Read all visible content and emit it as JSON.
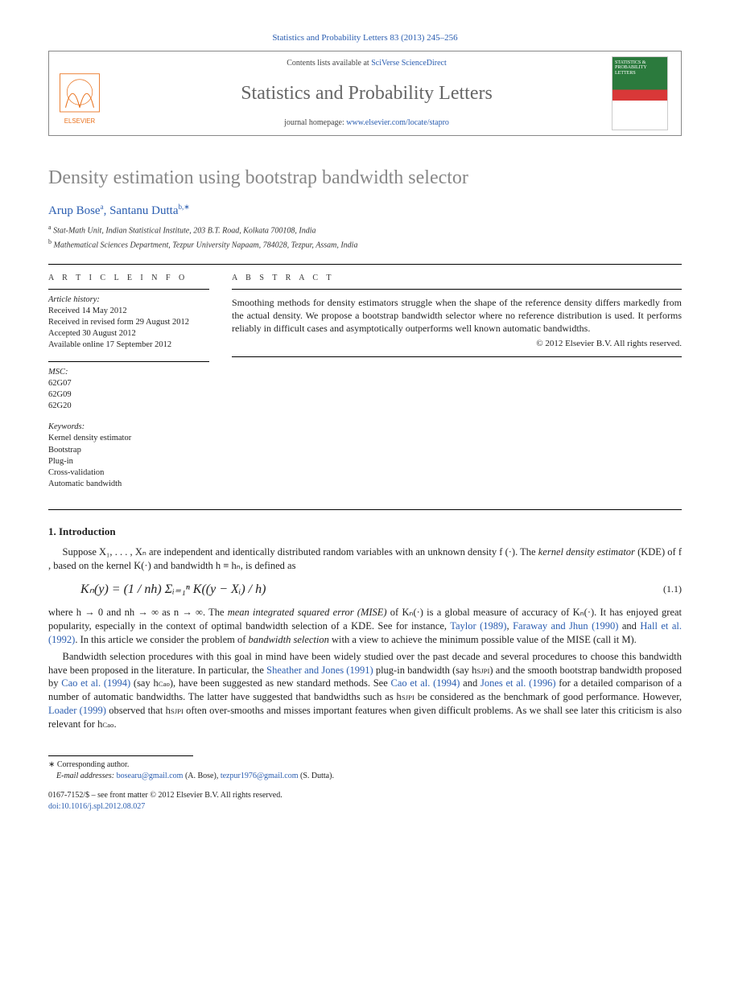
{
  "citation": "Statistics and Probability Letters 83 (2013) 245–256",
  "journalBox": {
    "contentsPrefix": "Contents lists available at ",
    "contentsLink": "SciVerse ScienceDirect",
    "journalName": "Statistics and Probability Letters",
    "homepagePrefix": "journal homepage: ",
    "homepageLink": "www.elsevier.com/locate/stapro",
    "coverTitle": "STATISTICS & PROBABILITY LETTERS"
  },
  "title": "Density estimation using bootstrap bandwidth selector",
  "authors": {
    "a1_name": "Arup Bose",
    "a1_sup": "a",
    "a2_name": "Santanu Dutta",
    "a2_sup": "b,∗"
  },
  "affiliations": {
    "a": "Stat-Math Unit, Indian Statistical Institute, 203 B.T. Road, Kolkata 700108, India",
    "b": "Mathematical Sciences Department, Tezpur University Napaam, 784028, Tezpur, Assam, India"
  },
  "articleInfo": {
    "label": "A R T I C L E   I N F O",
    "historyLabel": "Article history:",
    "h1": "Received 14 May 2012",
    "h2": "Received in revised form 29 August 2012",
    "h3": "Accepted 30 August 2012",
    "h4": "Available online 17 September 2012",
    "mscLabel": "MSC:",
    "msc1": "62G07",
    "msc2": "62G09",
    "msc3": "62G20",
    "kwLabel": "Keywords:",
    "kw1": "Kernel density estimator",
    "kw2": "Bootstrap",
    "kw3": "Plug-in",
    "kw4": "Cross-validation",
    "kw5": "Automatic bandwidth"
  },
  "abstract": {
    "label": "A B S T R A C T",
    "text": "Smoothing methods for density estimators struggle when the shape of the reference density differs markedly from the actual density. We propose a bootstrap bandwidth selector where no reference distribution is used. It performs reliably in difficult cases and asymptotically outperforms well known automatic bandwidths.",
    "copyright": "© 2012 Elsevier B.V. All rights reserved."
  },
  "sections": {
    "s1": "1. Introduction"
  },
  "intro": {
    "p1a": "Suppose X₁, . . . , Xₙ are independent and identically distributed random variables with an unknown density f (·). The ",
    "p1b_i": "kernel density estimator",
    "p1c": " (KDE) of f , based on the kernel K(·) and bandwidth h ≡ hₙ, is defined as",
    "eq": "Kₙ(y) = (1 / nh) Σᵢ₌₁ⁿ K((y − Xᵢ) / h)",
    "eqnum": "(1.1)",
    "p2a": "where h → 0 and nh → ∞ as n → ∞. The ",
    "p2b_i": "mean integrated squared error (MISE)",
    "p2c": " of Kₙ(·) is a global measure of accuracy of Kₙ(·). It has enjoyed great popularity, especially in the context of optimal bandwidth selection of a KDE. See for instance, ",
    "r1": "Taylor (1989)",
    "p2d": ", ",
    "r2": "Faraway and Jhun (1990)",
    "p2e": " and ",
    "r3": "Hall et al. (1992)",
    "p2f": ". In this article we consider the problem of ",
    "p2g_i": "bandwidth selection",
    "p2h": " with a view to achieve the minimum possible value of the MISE (call it M).",
    "p3a": "Bandwidth selection procedures with this goal in mind have been widely studied over the past decade and several procedures to choose this bandwidth have been proposed in the literature. In particular, the ",
    "r4": "Sheather and Jones (1991)",
    "p3b": " plug-in bandwidth (say h",
    "p3b_sub": "SJPI",
    "p3c": ") and the smooth bootstrap bandwidth proposed by ",
    "r5": "Cao et al. (1994)",
    "p3d": " (say h",
    "p3d_sub": "Cao",
    "p3e": "), have been suggested as new standard methods. See ",
    "r6": "Cao et al. (1994)",
    "p3f": " and ",
    "r7": "Jones et al. (1996)",
    "p3g": " for a detailed comparison of a number of automatic bandwidths. The latter have suggested that bandwidths such as h",
    "p3g_sub": "SJPI",
    "p3h": " be considered as the benchmark of good performance. However, ",
    "r8": "Loader (1999)",
    "p3i": " observed that h",
    "p3i_sub": "SJPI",
    "p3j": " often over-smooths and misses important features when given difficult problems. As we shall see later this criticism is also relevant for h",
    "p3j_sub": "Cao",
    "p3k": "."
  },
  "footer": {
    "corr": "∗ Corresponding author.",
    "emailsLabel": "E-mail addresses: ",
    "email1": "bosearu@gmail.com",
    "email1_who": " (A. Bose), ",
    "email2": "tezpur1976@gmail.com",
    "email2_who": " (S. Dutta).",
    "issn": "0167-7152/$ – see front matter © 2012 Elsevier B.V. All rights reserved.",
    "doiLabel": "doi:",
    "doi": "10.1016/j.spl.2012.08.027"
  }
}
